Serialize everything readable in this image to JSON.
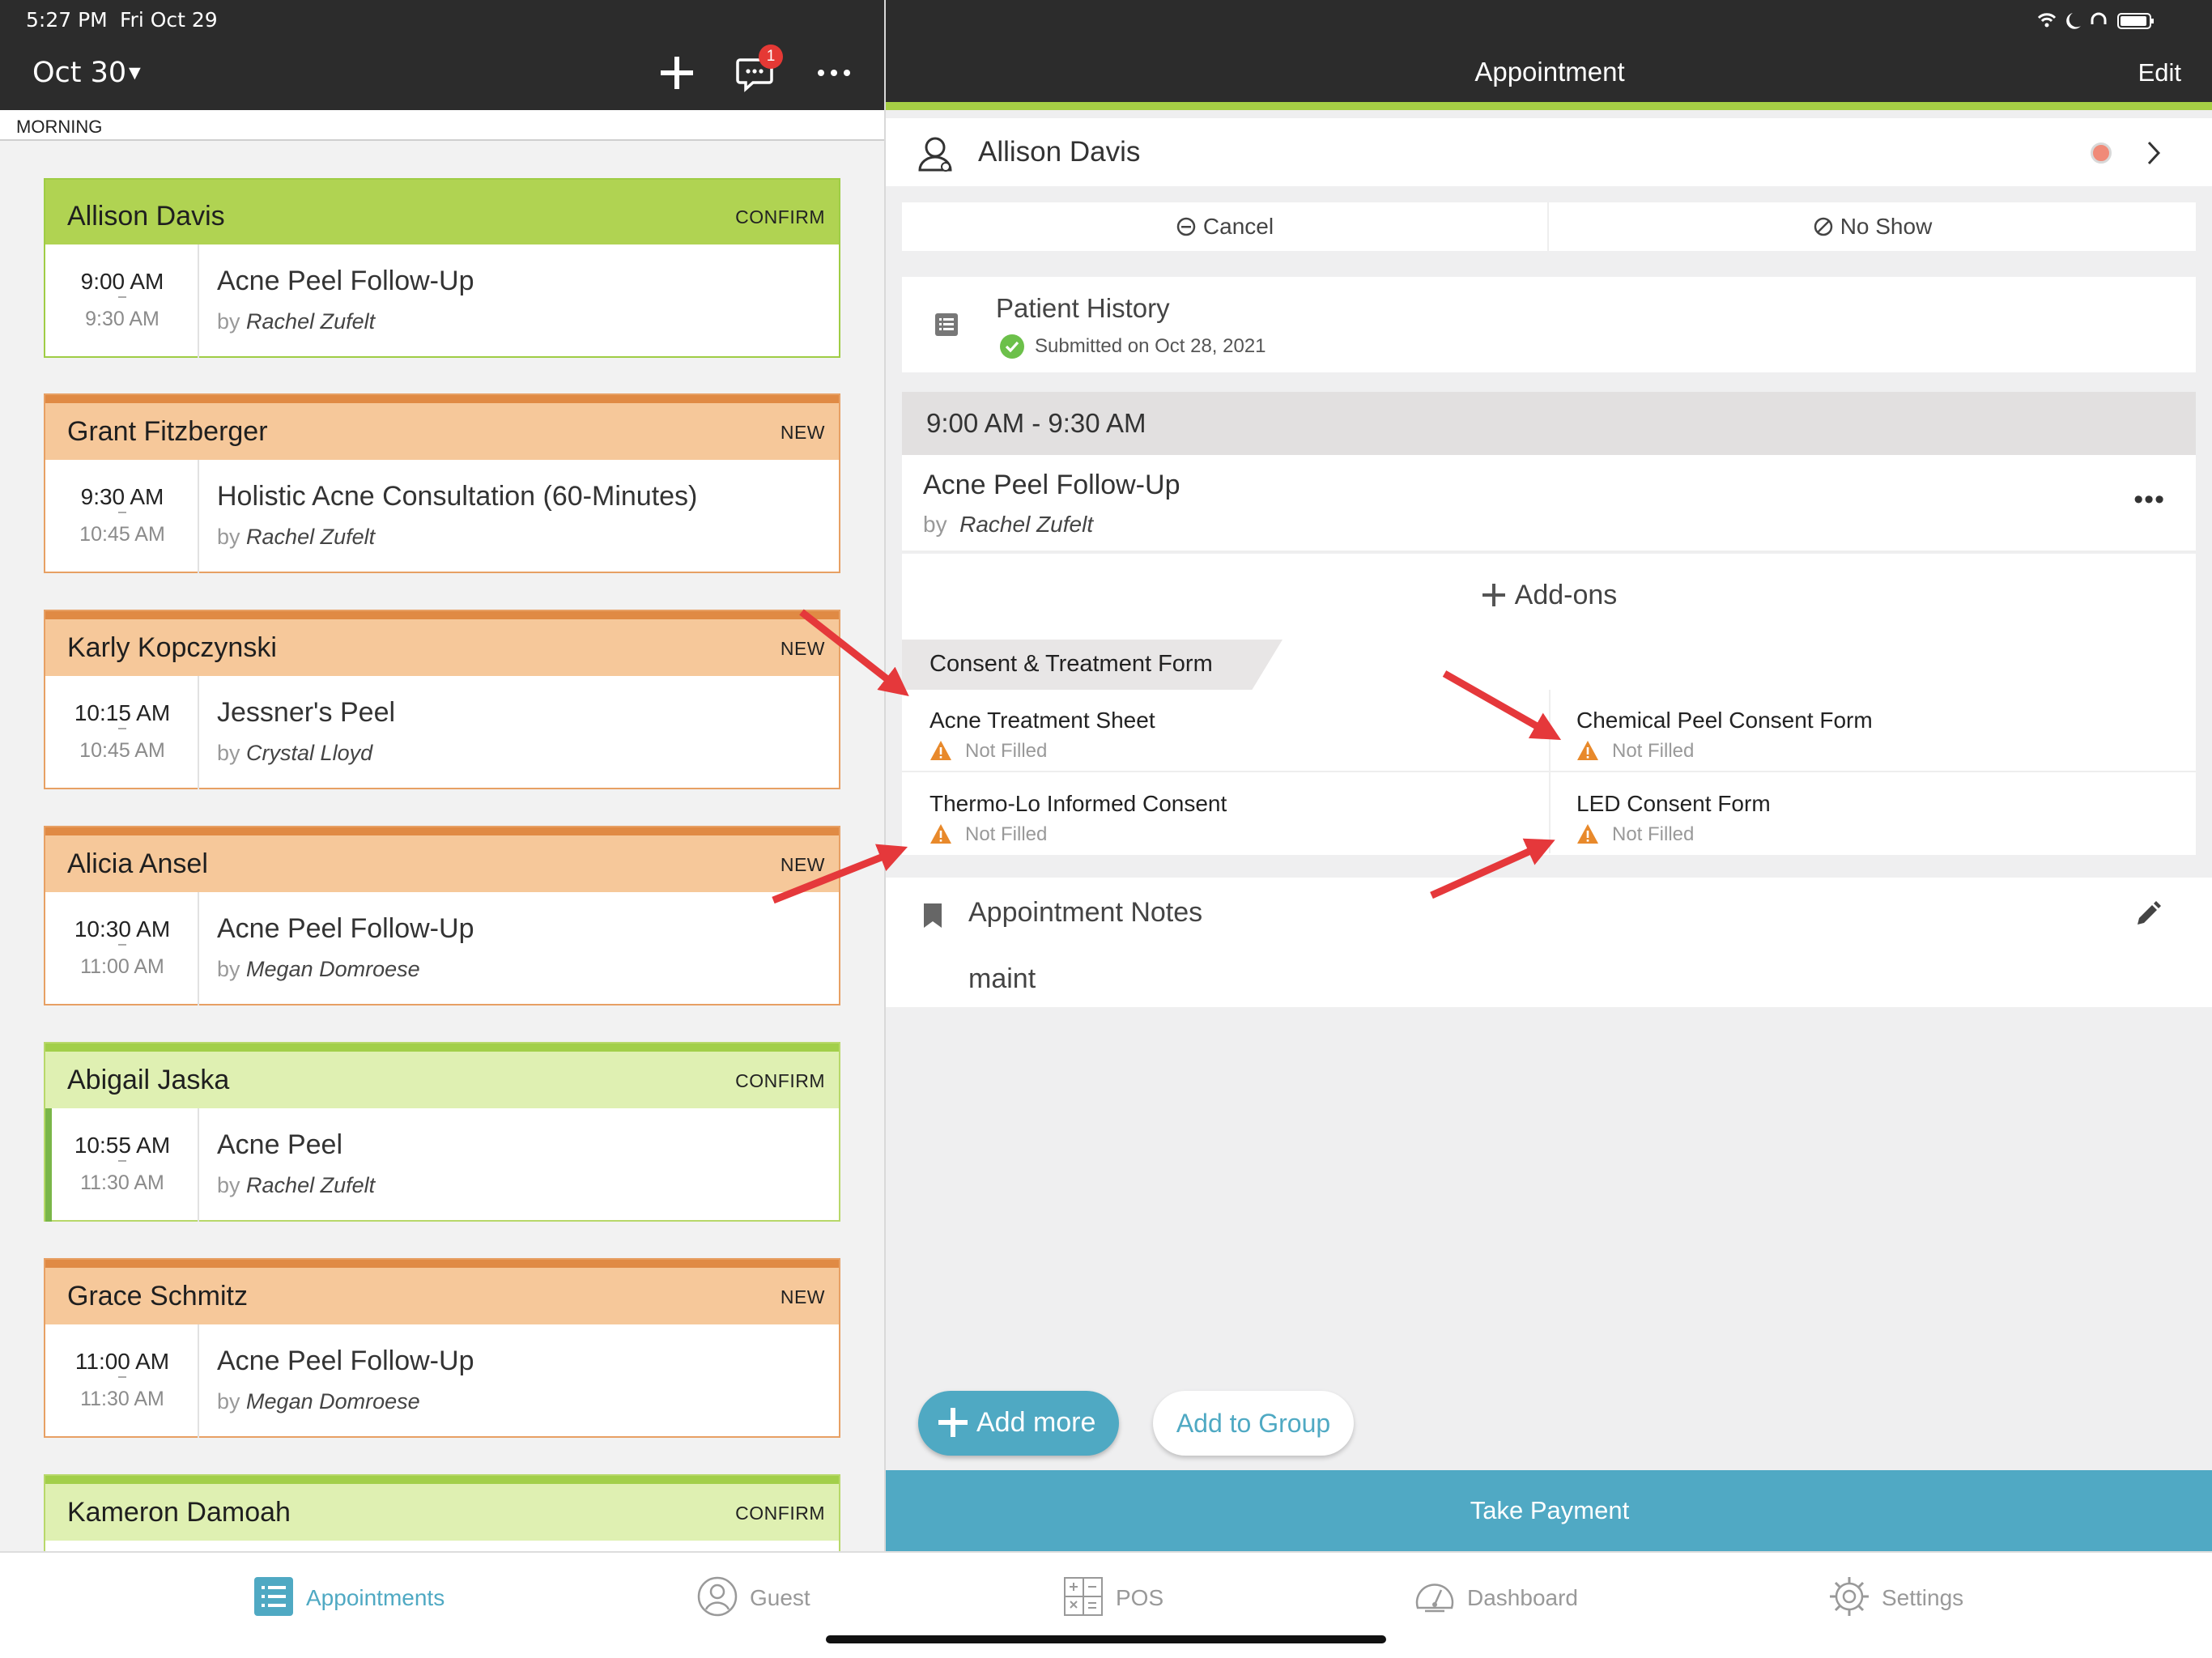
{
  "status_bar": {
    "time": "5:27 PM",
    "date": "Fri Oct 29"
  },
  "left_header": {
    "date_selector": "Oct 30",
    "caret": "▼",
    "badge_count": "1"
  },
  "section_label": "MORNING",
  "appointments": [
    {
      "name": "Allison Davis",
      "status": "CONFIRM",
      "start": "9:00 AM",
      "end": "9:30 AM",
      "service": "Acne Peel Follow-Up",
      "by_label": "by",
      "provider": "Rachel Zufelt",
      "theme": "green"
    },
    {
      "name": "Grant Fitzberger",
      "status": "NEW",
      "start": "9:30 AM",
      "end": "10:45 AM",
      "service": "Holistic Acne Consultation (60-Minutes)",
      "by_label": "by",
      "provider": "Rachel Zufelt",
      "theme": "orange"
    },
    {
      "name": "Karly Kopczynski",
      "status": "NEW",
      "start": "10:15 AM",
      "end": "10:45 AM",
      "service": "Jessner's Peel",
      "by_label": "by",
      "provider": "Crystal Lloyd",
      "theme": "orange"
    },
    {
      "name": "Alicia Ansel",
      "status": "NEW",
      "start": "10:30 AM",
      "end": "11:00 AM",
      "service": "Acne Peel Follow-Up",
      "by_label": "by",
      "provider": "Megan Domroese",
      "theme": "orange"
    },
    {
      "name": "Abigail Jaska",
      "status": "CONFIRM",
      "start": "10:55 AM",
      "end": "11:30 AM",
      "service": "Acne Peel",
      "by_label": "by",
      "provider": "Rachel Zufelt",
      "theme": "lgreen"
    },
    {
      "name": "Grace Schmitz",
      "status": "NEW",
      "start": "11:00 AM",
      "end": "11:30 AM",
      "service": "Acne Peel Follow-Up",
      "by_label": "by",
      "provider": "Megan Domroese",
      "theme": "orange"
    },
    {
      "name": "Kameron Damoah",
      "status": "CONFIRM",
      "theme": "lgreen"
    }
  ],
  "right_header": {
    "title": "Appointment",
    "edit": "Edit"
  },
  "patient": {
    "name": "Allison Davis"
  },
  "actions": {
    "cancel": "Cancel",
    "no_show": "No Show"
  },
  "history": {
    "title": "Patient History",
    "subtitle": "Submitted on Oct 28, 2021"
  },
  "appointment": {
    "time_range": "9:00 AM - 9:30 AM",
    "service": "Acne Peel Follow-Up",
    "by_label": "by",
    "provider": "Rachel Zufelt",
    "more": "•••",
    "addons_label": "Add-ons"
  },
  "forms": {
    "section_title": "Consent & Treatment Form",
    "items": [
      {
        "title": "Acne Treatment Sheet",
        "status": "Not Filled"
      },
      {
        "title": "Chemical Peel Consent Form",
        "status": "Not Filled"
      },
      {
        "title": "Thermo-Lo Informed Consent",
        "status": "Not Filled"
      },
      {
        "title": "LED Consent Form",
        "status": "Not Filled"
      }
    ]
  },
  "notes": {
    "title": "Appointment Notes",
    "body": "maint"
  },
  "buttons": {
    "add_more": "Add more",
    "add_to_group": "Add to Group",
    "take_payment": "Take Payment"
  },
  "tabs": [
    {
      "label": "Appointments",
      "icon": "list-icon",
      "active": true
    },
    {
      "label": "Guest",
      "icon": "person-icon",
      "active": false
    },
    {
      "label": "POS",
      "icon": "calculator-icon",
      "active": false
    },
    {
      "label": "Dashboard",
      "icon": "gauge-icon",
      "active": false
    },
    {
      "label": "Settings",
      "icon": "gear-icon",
      "active": false
    }
  ],
  "colors": {
    "header_bg": "#2c2c2c",
    "accent_green": "#a6cf45",
    "accent_blue": "#50a9c4",
    "orange_card": "#f6c89a",
    "warning": "#e8892b",
    "arrow_red": "#e5383b"
  }
}
